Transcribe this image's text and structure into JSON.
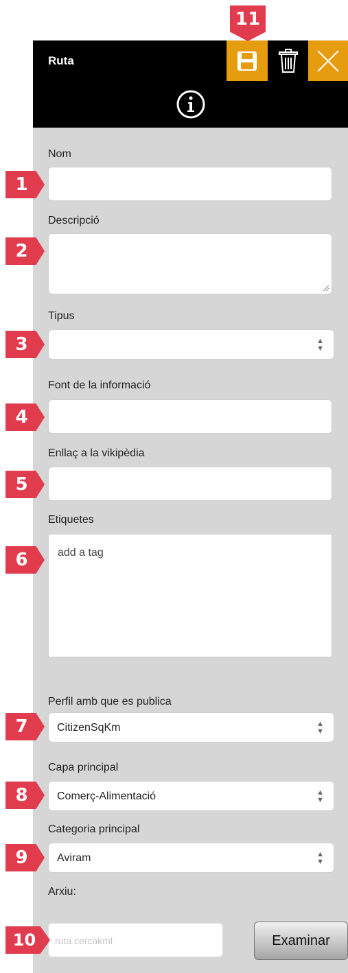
{
  "panel": {
    "title": "Ruta",
    "header_icons": [
      "save-icon",
      "trash-icon",
      "close-icon"
    ],
    "info_icon": "info-icon"
  },
  "form": {
    "nom_label": "Nom",
    "descripcio_label": "Descripció",
    "tipus_label": "Tipus",
    "tipus_value": "",
    "font_label": "Font de la informació",
    "enllac_label": "Enllaç a la vikipèdia",
    "etiquetes_label": "Etiquetes",
    "etiquetes_placeholder": "add a tag",
    "perfil_label": "Perfil amb que es publica",
    "perfil_value": "CitizenSqKm",
    "capa_label": "Capa principal",
    "capa_value": "Comerç-Alimentació",
    "categoria_label": "Categoria principal",
    "categoria_value": "Aviram",
    "arxiu_label": "Arxiu:",
    "arxiu_placeholder": "ruta.cercakml",
    "examinar_label": "Examinar"
  },
  "badges": [
    "1",
    "2",
    "3",
    "4",
    "5",
    "6",
    "7",
    "8",
    "9",
    "10",
    "11"
  ],
  "colors": {
    "accent": "#e59c0f",
    "badge": "#e03c4d",
    "panel_bg": "#d6d6d6",
    "header_bg": "#000000"
  }
}
